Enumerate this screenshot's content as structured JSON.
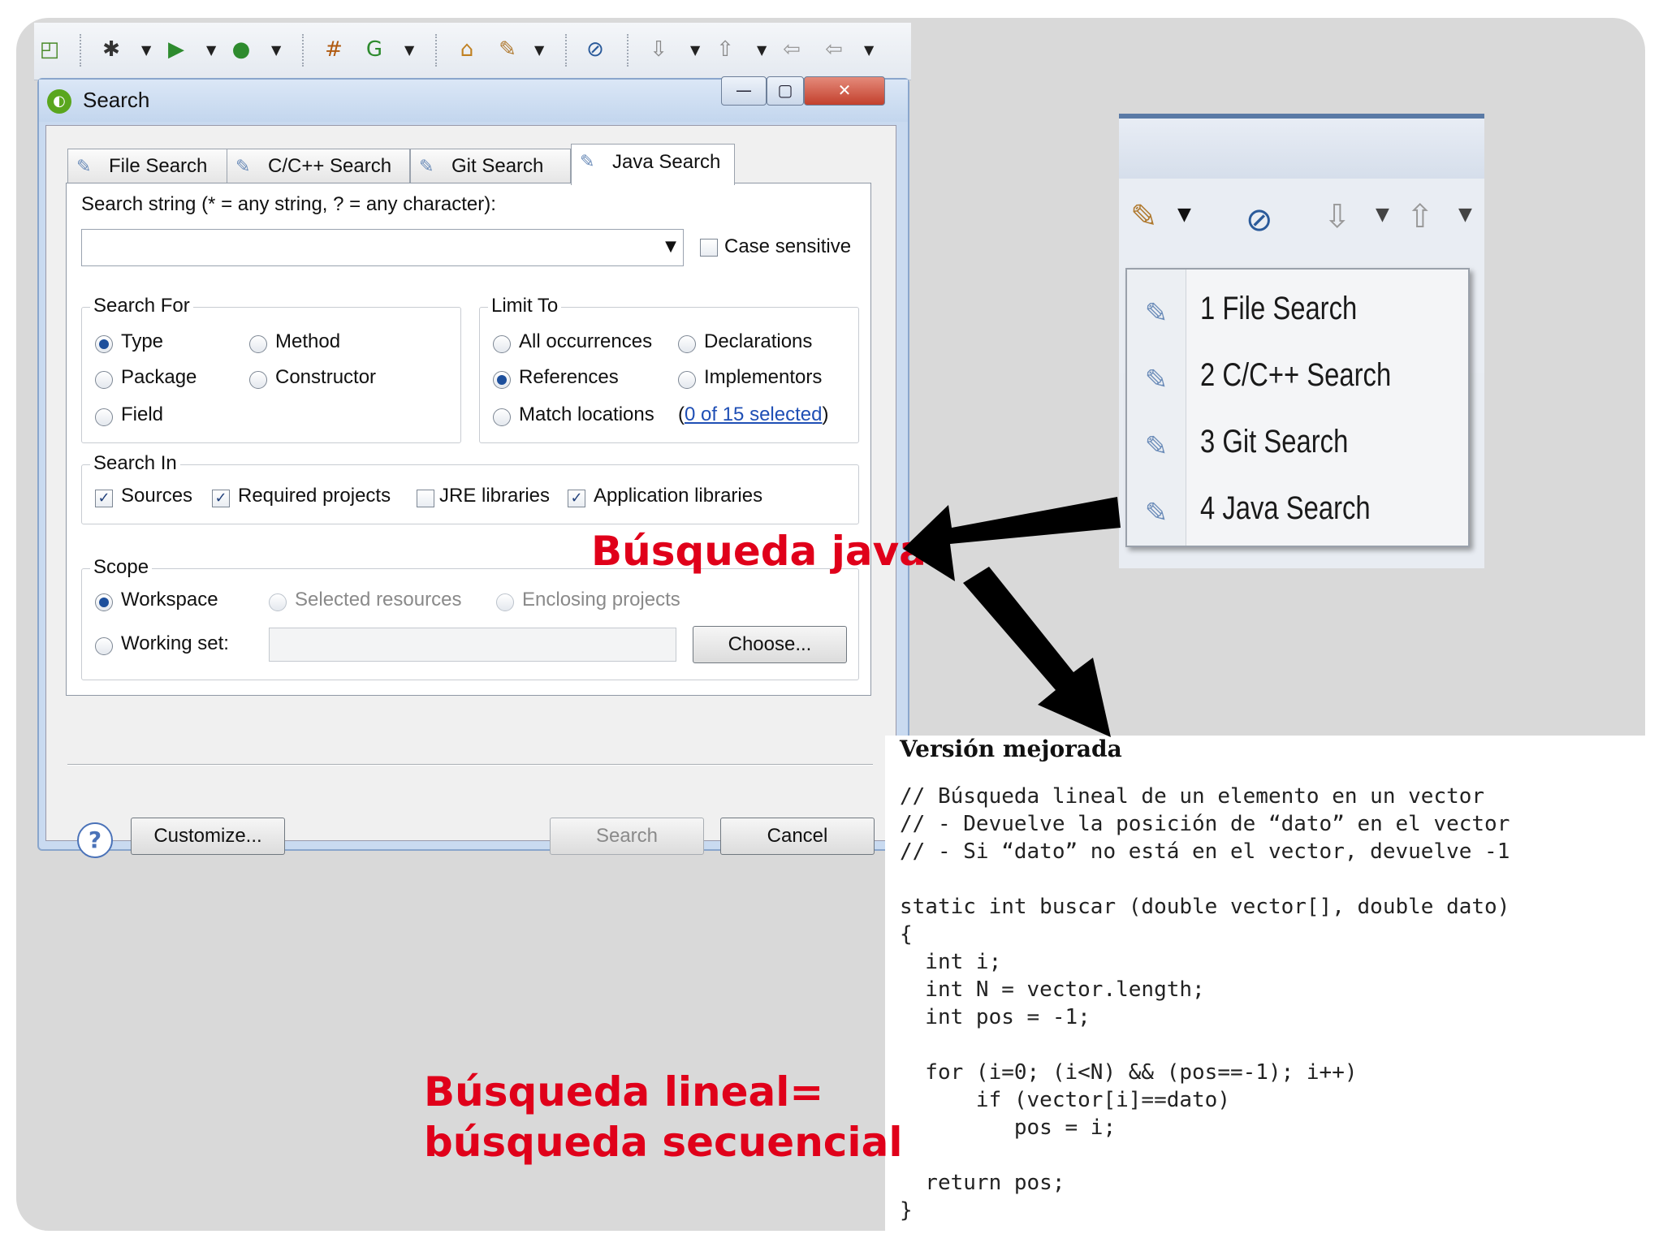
{
  "toolbar": {
    "icons": [
      "new-icon",
      "debug-icon",
      "run-icon",
      "external-tools-icon",
      "new-java-project-icon",
      "new-class-icon",
      "open-type-icon",
      "search-icon",
      "skip-breakpoints-icon",
      "next-annotation-icon",
      "previous-annotation-icon",
      "back-icon",
      "forward-icon"
    ]
  },
  "dialog": {
    "title": "Search",
    "tabs": [
      {
        "label": "File Search",
        "icon": "file-search-icon"
      },
      {
        "label": "C/C++ Search",
        "icon": "cpp-search-icon"
      },
      {
        "label": "Git Search",
        "icon": "git-search-icon"
      },
      {
        "label": "Java Search",
        "icon": "java-search-icon"
      }
    ],
    "search_string_label": "Search string (* = any string, ? = any character):",
    "search_string_value": "",
    "case_sensitive_label": "Case sensitive",
    "search_for": {
      "title": "Search For",
      "options": [
        "Type",
        "Method",
        "Package",
        "Constructor",
        "Field"
      ],
      "selected": "Type"
    },
    "limit_to": {
      "title": "Limit To",
      "options": [
        "All occurrences",
        "Declarations",
        "References",
        "Implementors",
        "Match locations"
      ],
      "selected": "References",
      "match_link": "0 of 15 selected",
      "paren_open": "(",
      "paren_close": ")"
    },
    "search_in": {
      "title": "Search In",
      "options": [
        {
          "label": "Sources",
          "checked": true
        },
        {
          "label": "Required projects",
          "checked": true
        },
        {
          "label": "JRE libraries",
          "checked": false
        },
        {
          "label": "Application libraries",
          "checked": true
        }
      ]
    },
    "scope": {
      "title": "Scope",
      "workspace": "Workspace",
      "selected_resources": "Selected resources",
      "enclosing_projects": "Enclosing projects",
      "working_set": "Working set:",
      "choose": "Choose..."
    },
    "buttons": {
      "customize": "Customize...",
      "search": "Search",
      "cancel": "Cancel",
      "help": "?"
    }
  },
  "menu": {
    "items": [
      {
        "label": "1 File Search",
        "icon": "file-search-icon"
      },
      {
        "label": "2 C/C++ Search",
        "icon": "cpp-search-icon"
      },
      {
        "label": "3 Git Search",
        "icon": "git-search-icon"
      },
      {
        "label": "4 Java Search",
        "icon": "java-search-icon"
      }
    ]
  },
  "annotations": {
    "busqueda_java": "Búsqueda java",
    "lineal_line1": "Búsqueda lineal=",
    "lineal_line2": "búsqueda secuencial"
  },
  "code_box": {
    "title": "Versión mejorada",
    "code": "// Búsqueda lineal de un elemento en un vector\n// - Devuelve la posición de “dato” en el vector\n// - Si “dato” no está en el vector, devuelve -1\n\nstatic int buscar (double vector[], double dato)\n{\n  int i;\n  int N = vector.length;\n  int pos = -1;\n\n  for (i=0; (i<N) && (pos==-1); i++)\n      if (vector[i]==dato)\n         pos = i;\n\n  return pos;\n}"
  },
  "colors": {
    "annotation_red": "#e0001a",
    "link_blue": "#1f4fb5"
  }
}
